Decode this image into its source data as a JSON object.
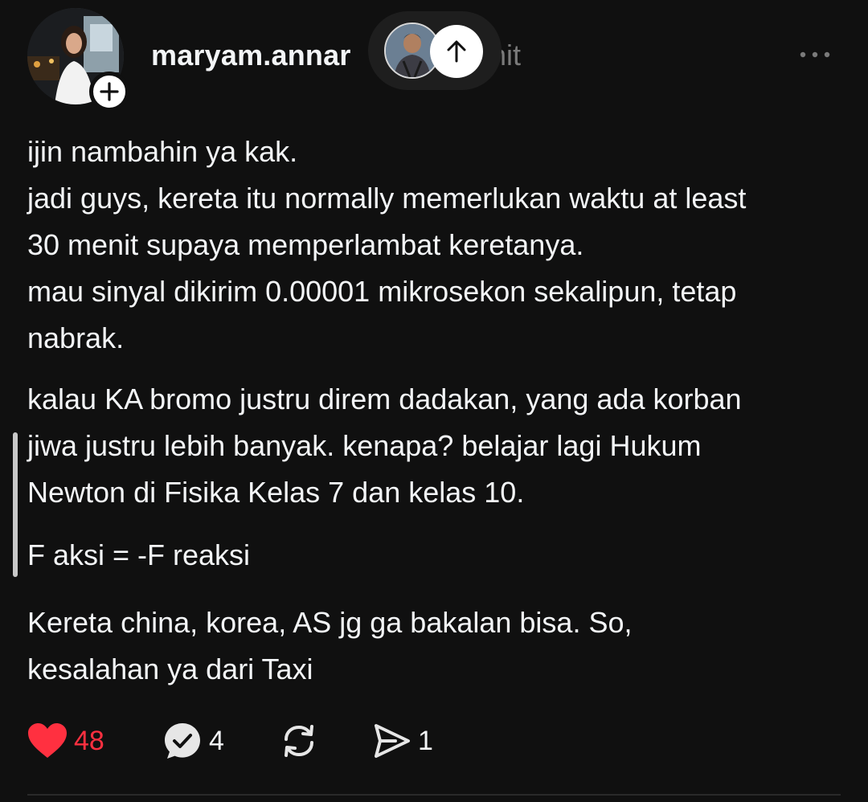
{
  "post": {
    "username": "maryam.annar",
    "timestamp": "nit",
    "paragraphs": [
      "ijin nambahin ya kak.\njadi guys, kereta itu normally memerlukan waktu at least 30 menit supaya memperlambat keretanya.\nmau sinyal dikirim 0.00001 mikrosekon sekalipun, tetap nabrak.",
      "kalau KA bromo justru direm dadakan, yang ada korban jiwa justru lebih banyak. kenapa? belajar lagi Hukum Newton di Fisika Kelas 7 dan kelas 10.",
      "F aksi = -F reaksi",
      "Kereta china, korea, AS jg ga bakalan bisa. So, kesalahan ya dari Taxi"
    ]
  },
  "actions": {
    "likes": "48",
    "replies": "4",
    "shares": "1"
  },
  "icons": {
    "like": "heart-icon",
    "reply": "comment-icon",
    "repost": "repost-icon",
    "share": "send-icon",
    "more": "more-dots-icon",
    "follow": "plus-icon",
    "scroll_up": "arrow-up-icon"
  },
  "colors": {
    "background": "#101010",
    "text": "#f3f5f7",
    "muted": "#7a7a7a",
    "like": "#ff3040"
  }
}
